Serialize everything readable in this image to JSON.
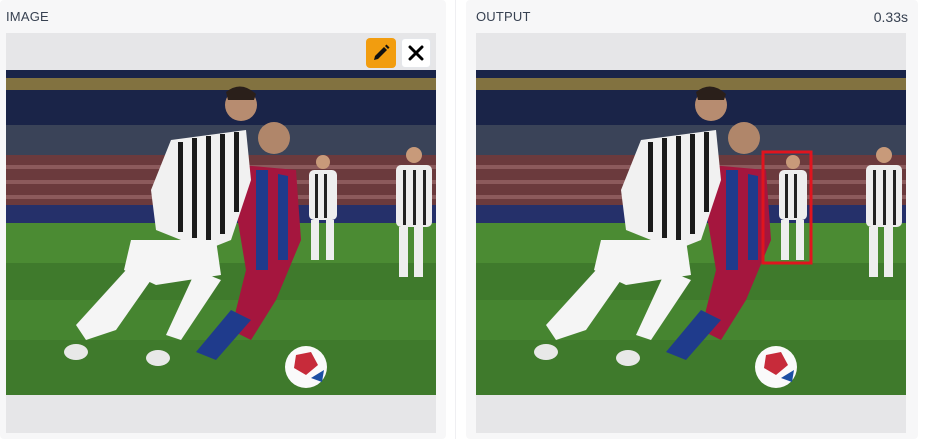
{
  "input_panel": {
    "label": "IMAGE",
    "buttons": {
      "edit_icon": "pencil-icon",
      "close_icon": "close-icon"
    }
  },
  "output_panel": {
    "label": "OUTPUT",
    "timing": "0.33s",
    "detection_box_color": "#e0141e"
  },
  "colors": {
    "edit_button": "#f29d0f",
    "panel_bg": "#f7f7f8",
    "frame_bg": "#e6e6e8"
  }
}
